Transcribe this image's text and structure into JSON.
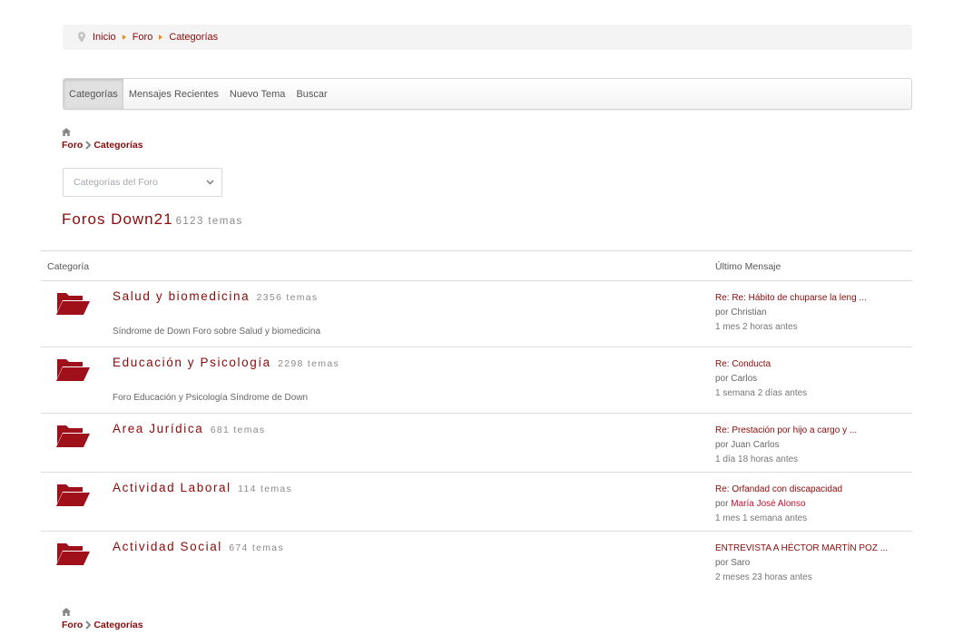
{
  "breadcrumb": {
    "items": [
      "Inicio",
      "Foro",
      "Categorías"
    ]
  },
  "tabs": [
    {
      "label": "Categorías",
      "active": true
    },
    {
      "label": "Mensajes Recientes",
      "active": false
    },
    {
      "label": "Nuevo Tema",
      "active": false
    },
    {
      "label": "Buscar",
      "active": false
    }
  ],
  "pathway": {
    "home_icon": "home-icon",
    "items": [
      "Foro",
      "Categorías"
    ]
  },
  "category_select": {
    "value": "Categorías del Foro"
  },
  "forum": {
    "title": "Foros Down21",
    "count": "6123 temas"
  },
  "table": {
    "col_category": "Categoría",
    "col_last": "Último Mensaje",
    "rows": [
      {
        "name": "Salud y biomedicina",
        "count": "2356 temas",
        "description": "Síndrome de Down Foro sobre Salud y biomedicina",
        "last_title": "Re: Re: Hábito de chuparse la leng ...",
        "by": "por",
        "user": "Christian",
        "time": "1 mes 2 horas antes"
      },
      {
        "name": "Educación y Psicología",
        "count": "2298 temas",
        "description": "Foro Educación y Psicología Síndrome de Down",
        "last_title": "Re: Conducta",
        "by": "por",
        "user": "Carlos",
        "time": "1 semana 2 días antes"
      },
      {
        "name": "Area Jurídica",
        "count": "681 temas",
        "description": "",
        "last_title": "Re: Prestación por hijo a cargo y ...",
        "by": "por",
        "user": "Juan Carlos",
        "time": "1 día 18 horas antes"
      },
      {
        "name": "Actividad Laboral",
        "count": "114 temas",
        "description": "",
        "last_title": "Re: Orfandad con discapacidad",
        "by": "por",
        "user": "María José Alonso",
        "time": "1 mes 1 semana antes"
      },
      {
        "name": "Actividad Social",
        "count": "674 temas",
        "description": "",
        "last_title": "ENTREVISTA A HÉCTOR MARTÍN POZ ...",
        "by": "por",
        "user": "Saro",
        "time": "2 meses 23 horas antes"
      }
    ]
  },
  "colors": {
    "brand": "#8b0a0a",
    "folder": "#a0101a",
    "moderator_user": "#c8102e",
    "breadcrumb_arrow": "#e8901f"
  }
}
